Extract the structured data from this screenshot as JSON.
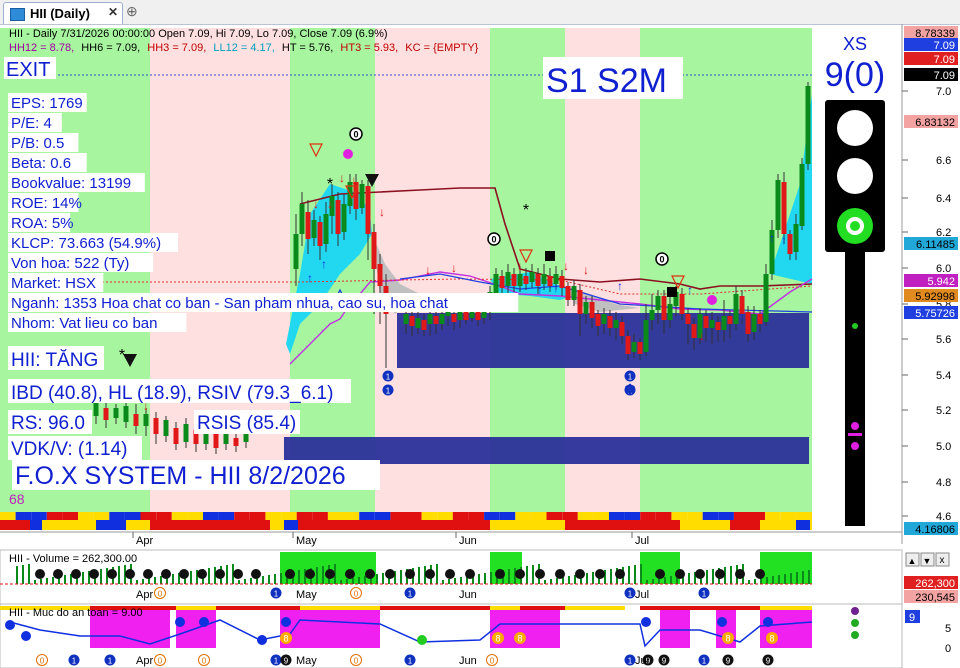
{
  "tab": {
    "title": "HII (Daily)"
  },
  "header": {
    "line1": "HII - Daily 7/31/2026 00:00:00 Open 7.09, Hi 7.09, Lo 7.09, Close 7.09 (6.9%)",
    "hh12": "HH12 = 8.78,",
    "hh6": "HH6 = 7.09,",
    "hh3": "HH3 = 7.09,",
    "ll12": "LL12 = 4.17,",
    "ht": "HT = 5.76,",
    "ht3": "HT3 = 5.93,",
    "kc": "KC = {EMPTY}"
  },
  "overlay": {
    "exit": "EXIT",
    "signal": "S1 S2M",
    "xs_label": "XS",
    "xs_value": "9(0)",
    "info_lines": [
      "EPS: 1769",
      "P/E: 4",
      "P/B: 0.5",
      "Beta: 0.6",
      "Bookvalue: 13199",
      "ROE: 14%",
      "ROA: 5%",
      "KLCP: 73.663 (54.9%)",
      "Von hoa: 522 (Ty)",
      "Market: HSX",
      "Nganh: 1353 Hoa chat co ban - San pham nhua, cao su, hoa chat",
      "Nhom: Vat lieu co ban"
    ],
    "trend": "HII: TĂNG",
    "ibd": "IBD (40.8), HL (18.9), RSIV (79.3_6.1)",
    "rs": "RS: 96.0",
    "rsis": "RSIS (85.4)",
    "vdk": "VDK/V:  (1.14)",
    "system": "F.O.X SYSTEM - HII 8/2/2026",
    "small_num": "68"
  },
  "chart_data": {
    "type": "candlestick",
    "months": [
      "Apr",
      "May",
      "Jun",
      "Jul"
    ],
    "y_ticks": [
      "7.0",
      "6.6",
      "6.4",
      "6.2",
      "6.0",
      "5.8",
      "5.6",
      "5.4",
      "5.2",
      "5.0",
      "4.8",
      "4.6"
    ],
    "price_tags": [
      {
        "label": "8.78339",
        "color": "#f4a3a3"
      },
      {
        "label": "7.09",
        "color": "#1f3fe0"
      },
      {
        "label": "7.09",
        "color": "#e02020"
      },
      {
        "label": "7.09",
        "color": "#000000"
      },
      {
        "label": "6.83132",
        "color": "#f4a3a3"
      },
      {
        "label": "6.11485",
        "color": "#22a8d8"
      },
      {
        "label": "5.942",
        "color": "#c020c0"
      },
      {
        "label": "5.92998",
        "color": "#e08a20"
      },
      {
        "label": "5.75726",
        "color": "#1f3fe0"
      },
      {
        "label": "4.16806",
        "color": "#22a8d8"
      }
    ],
    "volume": {
      "title": "HII - Volume = 262,300.00",
      "tags": [
        "262,300",
        "230,545"
      ]
    },
    "safety": {
      "title": "HII - Muc do an toan = 9.00",
      "value_tag": "9",
      "y_ticks": [
        "5",
        "0"
      ]
    },
    "toolbar_glyphs": [
      "▲",
      "▼",
      "x"
    ]
  }
}
